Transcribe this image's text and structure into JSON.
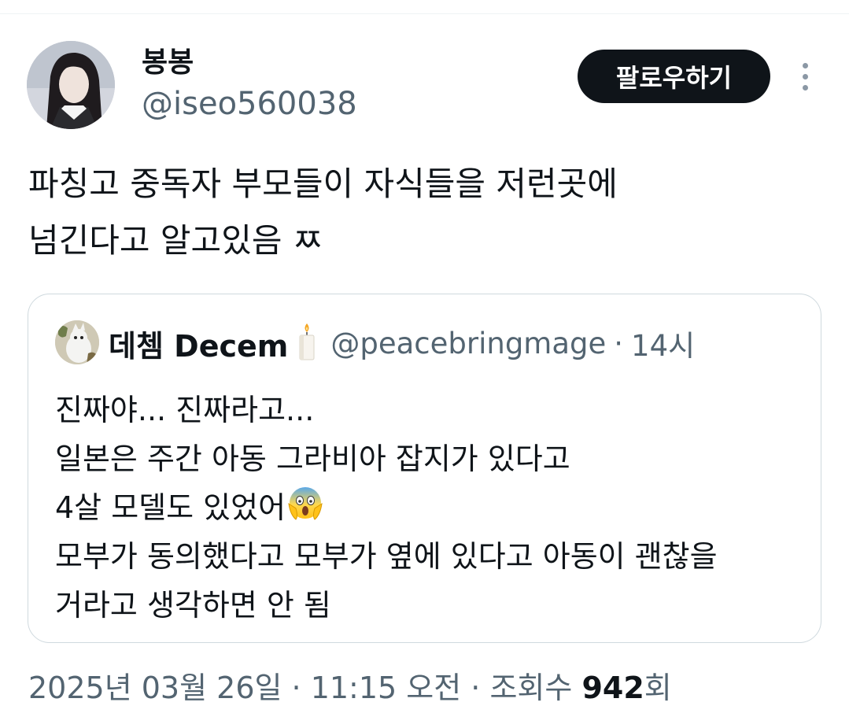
{
  "author": {
    "display_name": "봉봉",
    "handle": "@iseo560038"
  },
  "actions": {
    "follow_label": "팔로우하기"
  },
  "tweet": {
    "text": "파칭고 중독자 부모들이 자식들을 저런곳에\n넘긴다고 알고있음 ㅉ"
  },
  "quoted_tweet": {
    "display_name": "데쳄 Decem",
    "handle": "@peacebringmage",
    "separator": "·",
    "time": "14시",
    "lines": [
      "진짜야... 진짜라고...",
      "일본은 주간 아동 그라비아 잡지가 있다고",
      "4살 모델도 있었어",
      "모부가 동의했다고 모부가 옆에 있다고 아동이 괜찮을",
      "거라고 생각하면 안 됨"
    ]
  },
  "meta": {
    "date": "2025년 03월 26일",
    "dot1": " · ",
    "time": "11:15 오전",
    "dot2": " · ",
    "views_label": "조회수 ",
    "views_count": "942",
    "views_suffix": "회"
  },
  "icons": {
    "more": "more-vertical-icon",
    "candle": "candle-icon",
    "scream_emoji": "screaming-face-icon"
  },
  "colors": {
    "text": "#0f1419",
    "secondary": "#536471",
    "border": "#cfd9de",
    "button_bg": "#0f1419"
  }
}
